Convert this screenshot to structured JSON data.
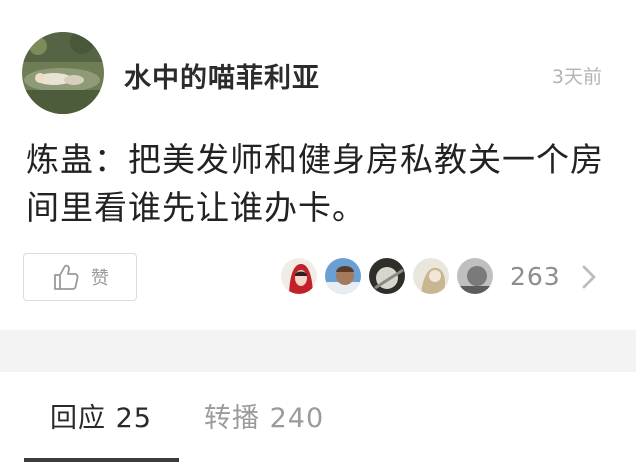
{
  "post": {
    "author": "水中的喵菲利亚",
    "time": "3天前",
    "content": "炼蛊：把美发师和健身房私教关一个房间里看谁先让谁办卡。"
  },
  "actions": {
    "like_label": "赞",
    "like_count": "263",
    "like_icon": "thumbs-up-icon",
    "more_icon": "chevron-right-icon"
  },
  "tabs": {
    "replies": "回应 25",
    "reposts": "转播 240"
  },
  "colors": {
    "text_primary": "#222222",
    "text_muted": "#b4b4b4",
    "separator": "#f3f3f3",
    "tab_active_underline": "#3c3c3c"
  }
}
